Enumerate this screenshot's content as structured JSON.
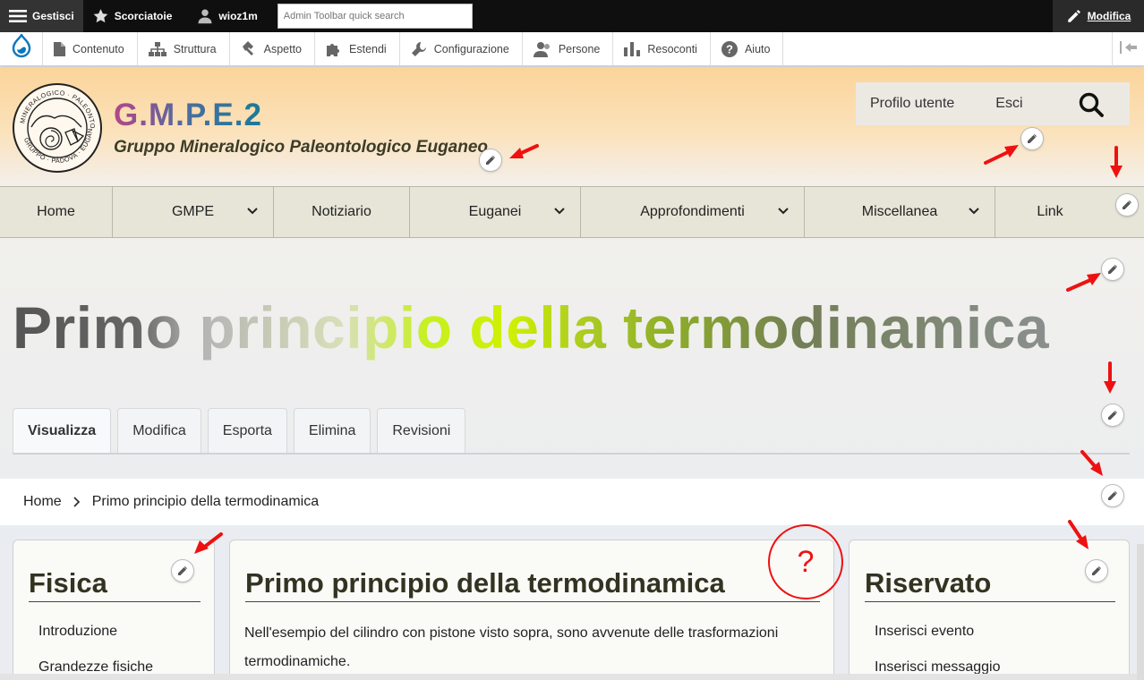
{
  "admin_bar": {
    "manage_label": "Gestisci",
    "shortcuts_label": "Scorciatoie",
    "user_label": "wioz1m",
    "search_placeholder": "Admin Toolbar quick search",
    "edit_label": "Modifica"
  },
  "tray": {
    "items": [
      {
        "label": "Contenuto",
        "icon": "file-icon"
      },
      {
        "label": "Struttura",
        "icon": "sitemap-icon"
      },
      {
        "label": "Aspetto",
        "icon": "paint-brush-icon"
      },
      {
        "label": "Estendi",
        "icon": "puzzle-icon"
      },
      {
        "label": "Configurazione",
        "icon": "wrench-icon"
      },
      {
        "label": "Persone",
        "icon": "people-icon"
      },
      {
        "label": "Resoconti",
        "icon": "bar-chart-icon"
      },
      {
        "label": "Aiuto",
        "icon": "help-icon"
      }
    ]
  },
  "header": {
    "site_name": "G.M.P.E.2",
    "slogan": "Gruppo Mineralogico Paleontologico Euganeo",
    "user_links": [
      "Profilo utente",
      "Esci"
    ],
    "logo_text": {
      "top": "MINERALOGICO · PALEONTOLOGICO",
      "bottom": "GRUPPO · PADOVA · EUGANEO"
    }
  },
  "main_nav": {
    "items": [
      {
        "label": "Home",
        "has_dropdown": false
      },
      {
        "label": "GMPE",
        "has_dropdown": true
      },
      {
        "label": "Notiziario",
        "has_dropdown": false
      },
      {
        "label": "Euganei",
        "has_dropdown": true
      },
      {
        "label": "Approfondimenti",
        "has_dropdown": true
      },
      {
        "label": "Miscellanea",
        "has_dropdown": true
      },
      {
        "label": "Link",
        "has_dropdown": false
      }
    ]
  },
  "page": {
    "title": "Primo principio della termodinamica",
    "tabs": [
      "Visualizza",
      "Modifica",
      "Esporta",
      "Elimina",
      "Revisioni"
    ],
    "active_tab": "Visualizza"
  },
  "breadcrumb": {
    "items": [
      "Home",
      "Primo principio della termodinamica"
    ]
  },
  "sidebar_left": {
    "title": "Fisica",
    "items": [
      "Introduzione",
      "Grandezze fisiche"
    ]
  },
  "main_content": {
    "title": "Primo principio della termodinamica",
    "text": "Nell'esempio del cilindro con pistone visto sopra, sono avvenute delle trasformazioni termodinamiche."
  },
  "sidebar_right": {
    "title": "Riservato",
    "items": [
      "Inserisci evento",
      "Inserisci messaggio"
    ]
  },
  "annotation": {
    "question_mark": "?"
  },
  "colors": {
    "annotation_red": "#ee1111",
    "toolbar_black": "#0f0f0f",
    "drupal_blue": "#0678be"
  }
}
